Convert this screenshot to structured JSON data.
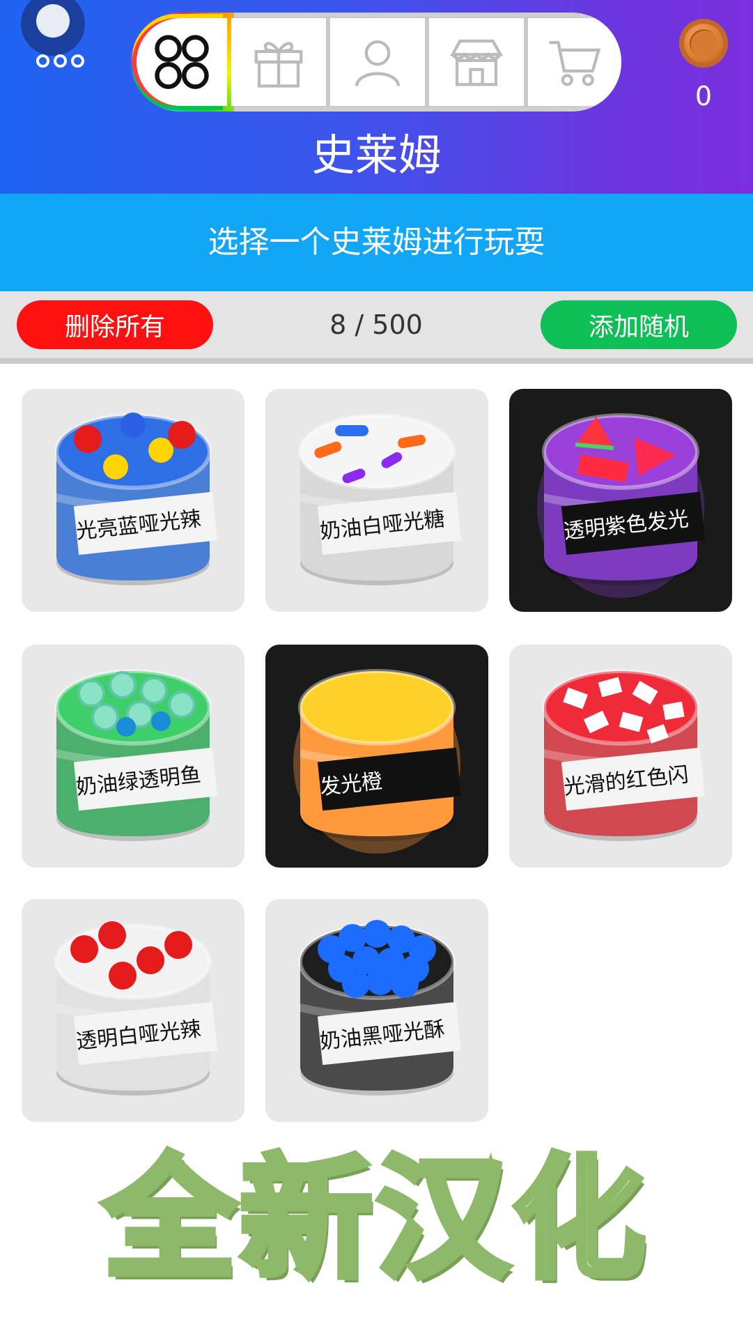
{
  "header": {
    "title": "史莱姆",
    "coins": "0",
    "tabs": [
      {
        "icon": "grid-icon",
        "active": true
      },
      {
        "icon": "gift-icon",
        "active": false
      },
      {
        "icon": "profile-icon",
        "active": false
      },
      {
        "icon": "shop-icon",
        "active": false
      },
      {
        "icon": "cart-icon",
        "active": false
      }
    ]
  },
  "subtitle": "选择一个史莱姆进行玩耍",
  "toolbar": {
    "delete_all": "删除所有",
    "counter": "8 / 500",
    "add_random": "添加随机"
  },
  "slimes": [
    {
      "label": "光亮蓝哑光辣",
      "slime_color": "#2f6fe6",
      "jar_color": "#4a7fd6",
      "topping": "balls-red-yellow",
      "dark": false
    },
    {
      "label": "奶油白哑光糖",
      "slime_color": "#f5f5f5",
      "jar_color": "#d8d8d8",
      "topping": "sprinkles",
      "dark": false
    },
    {
      "label": "透明紫色发光",
      "slime_color": "#9a3fd8",
      "jar_color": "#7d3bbf",
      "topping": "watermelon",
      "dark": true
    },
    {
      "label": "奶油绿透明鱼",
      "slime_color": "#3fcf6a",
      "jar_color": "#4caf6c",
      "topping": "glass-beads",
      "dark": false
    },
    {
      "label": "发光橙",
      "slime_color": "#ffd02a",
      "jar_color": "#ff9a3c",
      "topping": "none",
      "dark": true
    },
    {
      "label": "光滑的红色闪",
      "slime_color": "#ef2b3a",
      "jar_color": "#d2484f",
      "topping": "flakes",
      "dark": false
    },
    {
      "label": "透明白哑光辣",
      "slime_color": "#f2f2f2",
      "jar_color": "#e1e1e1",
      "topping": "balls-red",
      "dark": false
    },
    {
      "label": "奶油黑哑光酥",
      "slime_color": "#1e1e1e",
      "jar_color": "#4a4a4a",
      "topping": "balls-blue",
      "dark": false
    }
  ],
  "banner": "全新汉化"
}
